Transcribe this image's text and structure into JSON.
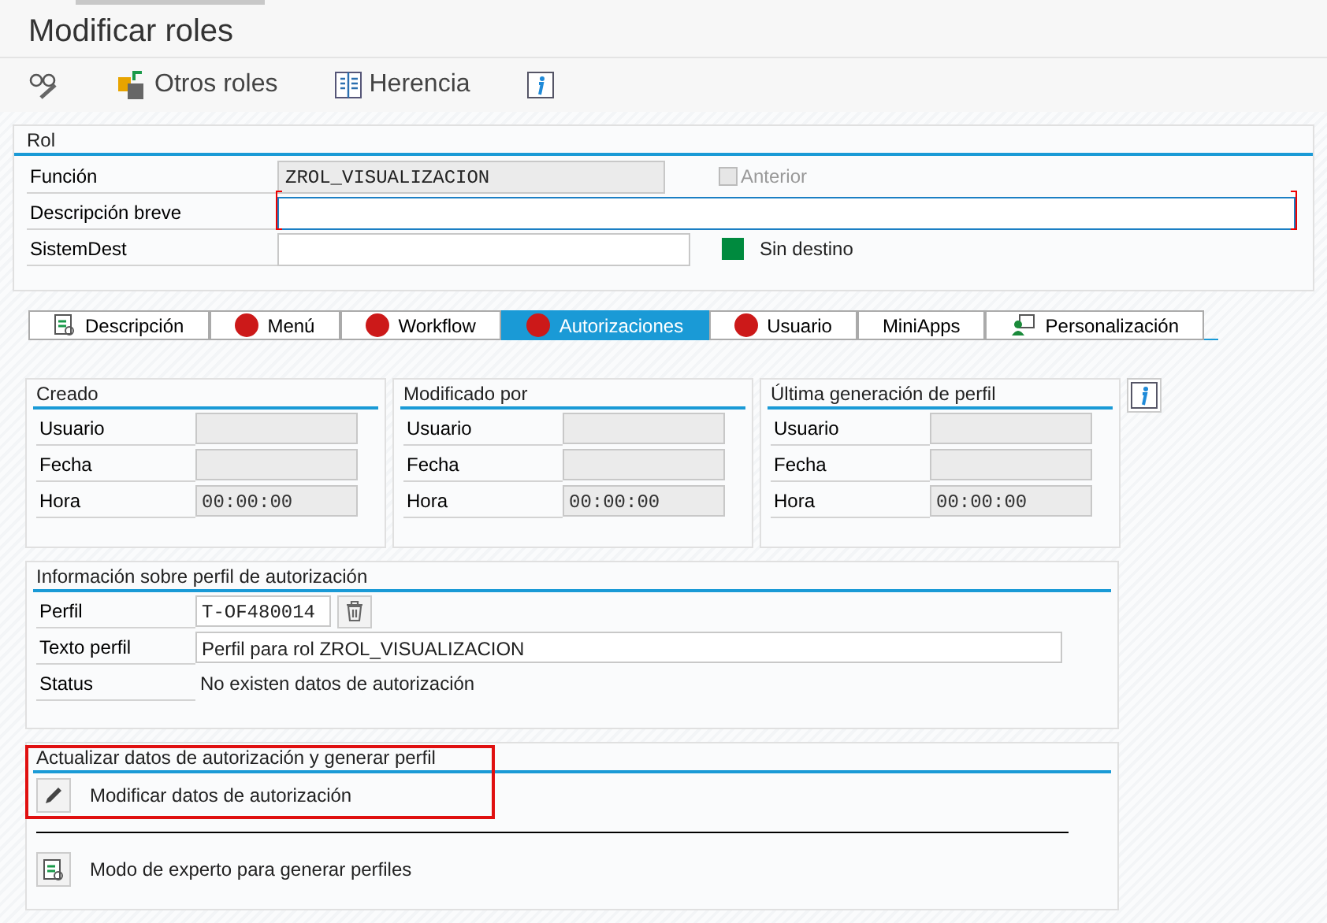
{
  "window": {
    "title": "Modificar roles"
  },
  "toolbar": [
    {
      "kind": "glasses"
    },
    {
      "kind": "transfer",
      "label": "Otros roles"
    },
    {
      "kind": "tree",
      "label": "Herencia"
    },
    {
      "kind": "info"
    }
  ],
  "rol": {
    "title": "Rol",
    "funcion": {
      "label": "Función",
      "value": "ZROL_VISUALIZACION",
      "disabled": true
    },
    "anterior": {
      "label": "Anterior",
      "checked": false,
      "disabled": true
    },
    "descripcion": {
      "label": "Descripción breve",
      "required": true,
      "focused": true
    },
    "sistem": {
      "label": "SistemDest"
    },
    "destino": {
      "label": "Sin destino",
      "color": "#008a3e"
    }
  },
  "tabs": [
    {
      "label": "Descripción",
      "kind": "doc",
      "selected": false
    },
    {
      "label": "Menú",
      "kind": "dot",
      "selected": false
    },
    {
      "label": "Workflow",
      "kind": "dot",
      "selected": false
    },
    {
      "label": "Autorizaciones",
      "kind": "dot",
      "selected": true
    },
    {
      "label": "Usuario",
      "kind": "dot",
      "selected": false
    },
    {
      "label": "MiniApps",
      "kind": "plain",
      "selected": false
    },
    {
      "label": "Personalización",
      "kind": "person",
      "selected": false
    }
  ],
  "panels": [
    {
      "title": "Creado",
      "rows": [
        {
          "label": "Usuario"
        },
        {
          "label": "Fecha"
        },
        {
          "label": "Hora",
          "value": "00:00:00"
        }
      ]
    },
    {
      "title": "Modificado por",
      "rows": [
        {
          "label": "Usuario"
        },
        {
          "label": "Fecha"
        },
        {
          "label": "Hora",
          "value": "00:00:00"
        }
      ]
    },
    {
      "title": "Última generación de perfil",
      "rows": [
        {
          "label": "Usuario"
        },
        {
          "label": "Fecha"
        },
        {
          "label": "Hora",
          "value": "00:00:00"
        }
      ]
    }
  ],
  "perfil": {
    "title": "Información sobre perfil de autorización",
    "rows": [
      {
        "kind": "field-delete",
        "label": "Perfil",
        "value": "T-OF480014"
      },
      {
        "kind": "field",
        "label": "Texto perfil",
        "value": "Perfil para rol ZROL_VISUALIZACION"
      },
      {
        "kind": "text",
        "label": "Status",
        "value": "No existen datos de autorización"
      }
    ]
  },
  "actualizar": {
    "title": "Actualizar datos de autorización y generar perfil",
    "highlighted": true,
    "actions": [
      {
        "kind": "pencil",
        "label": "Modificar datos de autorización"
      },
      {
        "kind": "expert",
        "label": "Modo de experto para generar perfiles"
      }
    ]
  }
}
